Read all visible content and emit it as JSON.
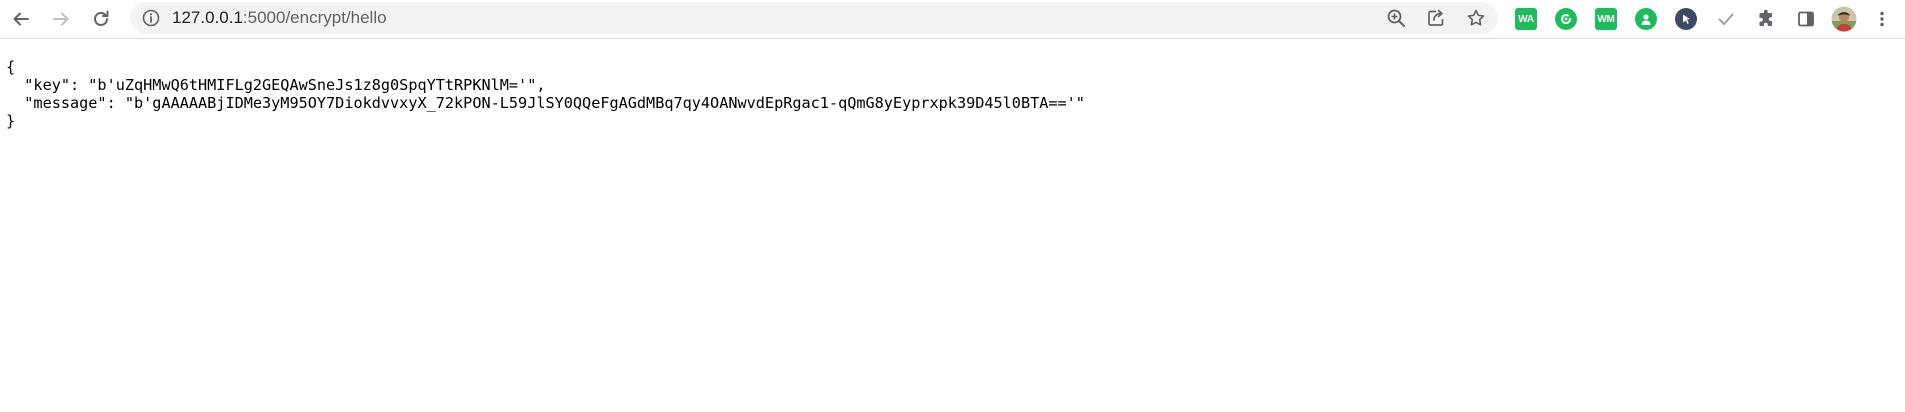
{
  "browser": {
    "url_host": "127.0.0.1",
    "url_path": ":5000/encrypt/hello",
    "icons": {
      "back": "arrow-left-icon",
      "forward": "arrow-right-icon",
      "reload": "reload-icon",
      "site_info": "info-icon",
      "zoom": "zoom-in-icon",
      "share": "share-icon",
      "bookmark": "star-icon",
      "extensions": "puzzle-icon",
      "side_panel": "side-panel-icon",
      "menu": "kebab-menu-icon"
    },
    "extensions": [
      {
        "label": "WA",
        "color": "#1fba5b"
      },
      {
        "label": "",
        "color": "#1fba5b",
        "icon": "chat-circle-icon"
      },
      {
        "label": "WM",
        "color": "#1fba5b"
      },
      {
        "label": "",
        "color": "#1fba5b",
        "icon": "person-circle-icon"
      },
      {
        "label": "",
        "color": "#3c4a66",
        "icon": "cursor-circle-icon"
      },
      {
        "label": "",
        "color": "#9aa0a6",
        "icon": "checkmark-icon"
      }
    ]
  },
  "json_body": {
    "open_brace": "{",
    "key_line": "  \"key\": \"b'uZqHMwQ6tHMIFLg2GEQAwSneJs1z8g0SpqYTtRPKNlM='\",",
    "message_line": "  \"message\": \"b'gAAAAABjIDMe3yM95OY7DiokdvvxyX_72kPON-L59JlSY0QQeFgAGdMBq7qy4OANwvdEpRgac1-qQmG8yEyprxpk39D45l0BTA=='\"",
    "close_brace": "}"
  }
}
